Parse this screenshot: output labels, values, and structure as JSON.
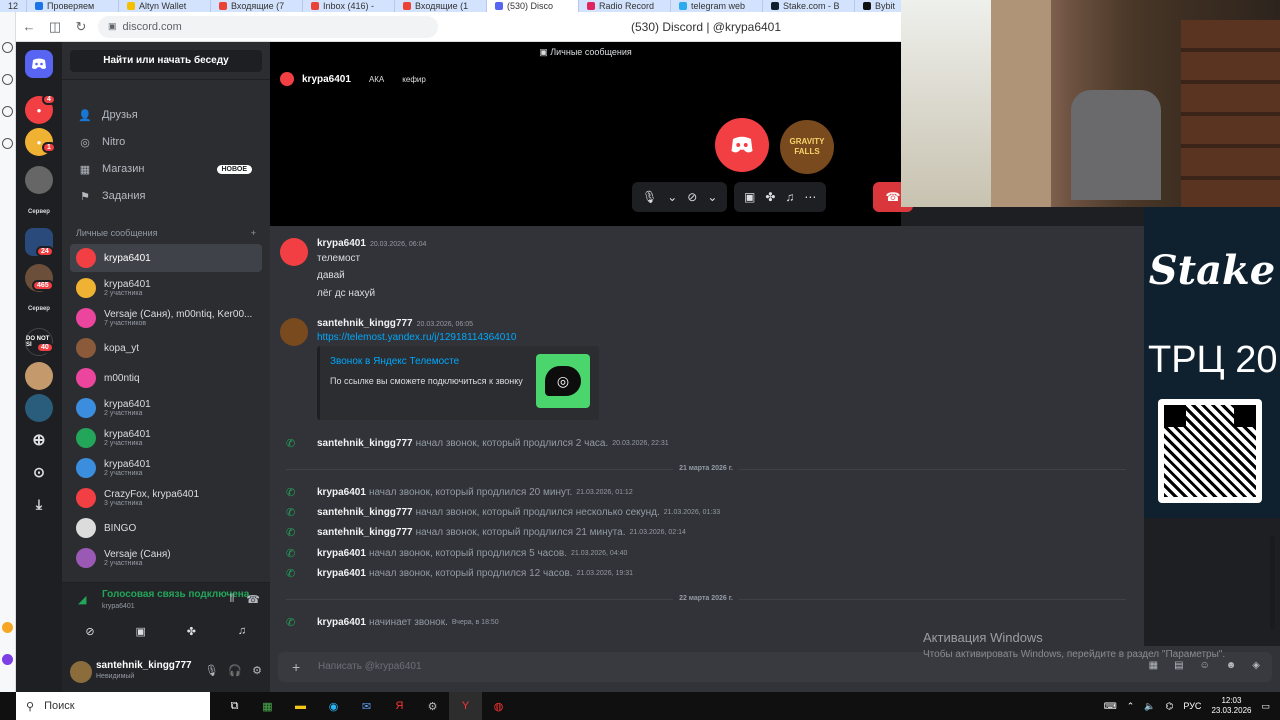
{
  "browser": {
    "tab_number": "12",
    "tabs": [
      {
        "label": "Проверяем",
        "color": "#1a73e8"
      },
      {
        "label": "Altyn Wallet",
        "color": "#f5c000"
      },
      {
        "label": "Входящие (7",
        "color": "#ea4335"
      },
      {
        "label": "Inbox (416) -",
        "color": "#ea4335"
      },
      {
        "label": "Входящие (1",
        "color": "#ea4335"
      },
      {
        "label": "(530) Disco",
        "color": "#5865f2"
      },
      {
        "label": "Radio Record",
        "color": "#e0245e"
      },
      {
        "label": "telegram web",
        "color": "#2aabee"
      },
      {
        "label": "Stake.com - B",
        "color": "#0f212e"
      },
      {
        "label": "Bybit",
        "color": "#111"
      }
    ],
    "url": "discord.com",
    "page_title": "(530) Discord | @krypa6401"
  },
  "rail": {
    "servers": [
      {
        "label": "",
        "color": "#5865f2",
        "icon": "discord-logo"
      },
      {
        "label": "",
        "color": "#f23f43",
        "badge": "4"
      },
      {
        "label": "",
        "color": "#f0b232",
        "badge": "1"
      },
      {
        "label": "",
        "color": "#555"
      },
      {
        "label": "",
        "color": "#3a6ea5",
        "badge": "24"
      },
      {
        "label": "",
        "color": "#6b4f3a",
        "badge": "465"
      },
      {
        "label": "",
        "color": "#1e1f22",
        "badge": "40"
      },
      {
        "label": "",
        "color": "#c49a6c"
      },
      {
        "label": "",
        "color": "#2a5d7c"
      }
    ],
    "texts": [
      "Сервер",
      "Сервер",
      "DO NOT SI"
    ]
  },
  "sidebar": {
    "search": "Найти или начать беседу",
    "nav": [
      {
        "label": "Друзья",
        "icon": "friends-icon"
      },
      {
        "label": "Nitro",
        "icon": "nitro-icon"
      },
      {
        "label": "Магазин",
        "icon": "shop-icon"
      },
      {
        "label": "Задания",
        "icon": "quests-icon"
      }
    ],
    "new_badge": "НОВОЕ",
    "dm_header": "Личные сообщения",
    "dms": [
      {
        "name": "krypa6401",
        "sub": "",
        "color": "#f23f43",
        "active": true
      },
      {
        "name": "krypa6401",
        "sub": "2 участника",
        "color": "#f0b232"
      },
      {
        "name": "Versaje (Саня), m00ntiq, Ker00...",
        "sub": "7 участников",
        "color": "#eb459e"
      },
      {
        "name": "kopa_yt",
        "sub": "",
        "color": "#8a5a3a"
      },
      {
        "name": "m00ntiq",
        "sub": "",
        "color": "#eb459e"
      },
      {
        "name": "krypa6401",
        "sub": "2 участника",
        "color": "#3b8ede"
      },
      {
        "name": "krypa6401",
        "sub": "2 участника",
        "color": "#23a55a"
      },
      {
        "name": "krypa6401",
        "sub": "2 участника",
        "color": "#3b8ede"
      },
      {
        "name": "CrazyFox, krypa6401",
        "sub": "3 участника",
        "color": "#f23f43"
      },
      {
        "name": "BINGO",
        "sub": "",
        "color": "#dcdcdc"
      },
      {
        "name": "Versaje (Саня)",
        "sub": "2 участника",
        "color": "#9b59b6"
      }
    ],
    "voice": {
      "title": "Голосовая связь подключена",
      "sub": "krypa6401"
    },
    "user": {
      "name": "santehnik_kingg777",
      "status": "Невидимый"
    }
  },
  "call": {
    "lstitle": "Личные сообщения",
    "user": "krypa6401",
    "extra1": "АКА",
    "extra2": "кефир",
    "avatar2_text": "GRAVITY FALLS"
  },
  "chat": {
    "msg1": {
      "author": "krypa6401",
      "time": "20.03.2026, 06:04",
      "lines": [
        "телемост",
        "давай",
        "лёг дс нахуй"
      ]
    },
    "msg2": {
      "author": "santehnik_kingg777",
      "time": "20.03.2026, 06:05",
      "link": "https://telemost.yandex.ru/j/12918114364010",
      "embed_title": "Звонок в Яндекс Телемосте",
      "embed_desc": "По ссылке вы сможете подключиться к звонку"
    },
    "calls": [
      {
        "who": "santehnik_kingg777",
        "act": "начал звонок, который продлился 2 часа.",
        "ts": "20.03.2026, 22:31"
      },
      {
        "who": "krypa6401",
        "act": "начал звонок, который продлился 20 минут.",
        "ts": "21.03.2026, 01:12"
      },
      {
        "who": "santehnik_kingg777",
        "act": "начал звонок, который продлился несколько секунд.",
        "ts": "21.03.2026, 01:33"
      },
      {
        "who": "santehnik_kingg777",
        "act": "начал звонок, который продлился 21 минута.",
        "ts": "21.03.2026, 02:14"
      },
      {
        "who": "krypa6401",
        "act": "начал звонок, который продлился 5 часов.",
        "ts": "21.03.2026, 04:40"
      },
      {
        "who": "krypa6401",
        "act": "начал звонок, который продлился 12 часов.",
        "ts": "21.03.2026, 19:31"
      },
      {
        "who": "krypa6401",
        "act": "начинает звонок.",
        "ts": "Вчера, в 18:50"
      }
    ],
    "dividers": [
      "21 марта 2026 г.",
      "22 марта 2026 г."
    ],
    "placeholder": "Написать @krypa6401"
  },
  "stake": {
    "logo": "Stake",
    "text": "ТРЦ 20"
  },
  "windows": {
    "activate": "Активация Windows",
    "hint": "Чтобы активировать Windows, перейдите в раздел \"Параметры\"."
  },
  "taskbar": {
    "search": "Поиск",
    "lang": "РУС",
    "time": "12:03",
    "date": "23.03.2026"
  }
}
